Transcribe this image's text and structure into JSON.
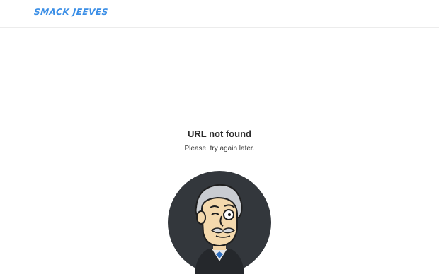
{
  "header": {
    "logo_text": "SMACK JEEVES"
  },
  "error": {
    "title": "URL not found",
    "message": "Please, try again later."
  },
  "mascot": {
    "icon": "butler-mascot-icon"
  },
  "colors": {
    "brand": "#3a8ee6",
    "mascot_bg": "#33373c",
    "header_border": "#ececec"
  }
}
